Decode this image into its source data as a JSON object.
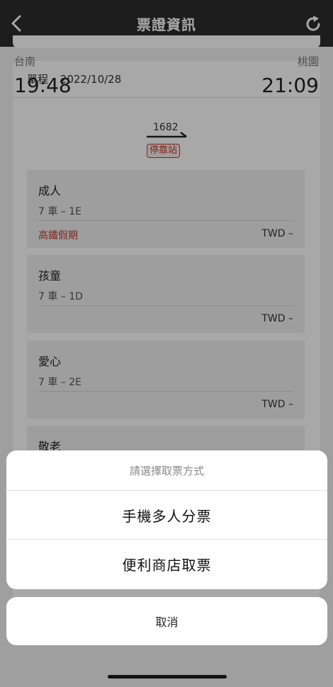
{
  "nav": {
    "title": "票證資訊",
    "back_icon": "chevron-left-icon",
    "refresh_icon": "refresh-icon"
  },
  "ticket": {
    "trip_type": "單程",
    "separator": "·",
    "date": "2022/10/28",
    "from_station": "台南",
    "to_station": "桃園",
    "depart_time": "19:48",
    "arrive_time": "21:09",
    "train_no": "1682",
    "stop_label": "停靠站",
    "passengers": [
      {
        "type": "成人",
        "seat": "7 車 – 1E",
        "promo": "高鐵假期",
        "price": "TWD –"
      },
      {
        "type": "孩童",
        "seat": "7 車 – 1D",
        "promo": "",
        "price": "TWD –"
      },
      {
        "type": "愛心",
        "seat": "7 車 – 2E",
        "promo": "",
        "price": "TWD –"
      },
      {
        "type": "敬老",
        "seat": "",
        "promo": "",
        "price": ""
      }
    ]
  },
  "sheet": {
    "title": "請選擇取票方式",
    "options": [
      "手機多人分票",
      "便利商店取票"
    ],
    "cancel": "取消"
  },
  "colors": {
    "nav_bg": "#2d2d2d",
    "accent_red": "#c0392b",
    "overlay": "rgba(0,0,0,0.34)"
  }
}
